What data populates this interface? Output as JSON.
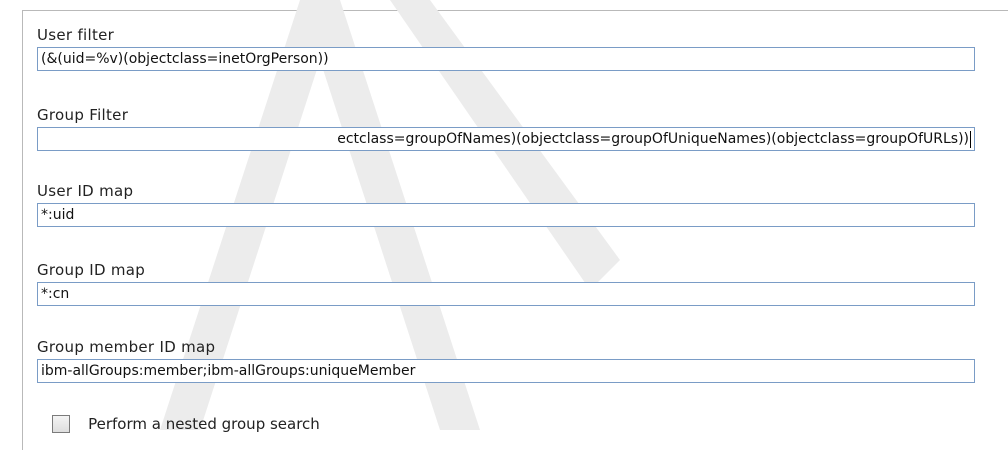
{
  "fields": {
    "user_filter": {
      "label": "User filter",
      "value": "(&(uid=%v)(objectclass=inetOrgPerson))"
    },
    "group_filter": {
      "label": "Group Filter",
      "value": "ectclass=groupOfNames)(objectclass=groupOfUniqueNames)(objectclass=groupOfURLs))"
    },
    "user_id_map": {
      "label": "User ID map",
      "value": "*:uid"
    },
    "group_id_map": {
      "label": "Group ID map",
      "value": "*:cn"
    },
    "group_member_id_map": {
      "label": "Group member ID map",
      "value": "ibm-allGroups:member;ibm-allGroups:uniqueMember"
    }
  },
  "checkbox": {
    "label": "Perform a nested group search",
    "checked": false
  },
  "watermark": {
    "text": "Draft"
  },
  "colors": {
    "input_border": "#7a9cc6",
    "frame_border": "#b9b9b9",
    "watermark": "#e9e9e9"
  }
}
